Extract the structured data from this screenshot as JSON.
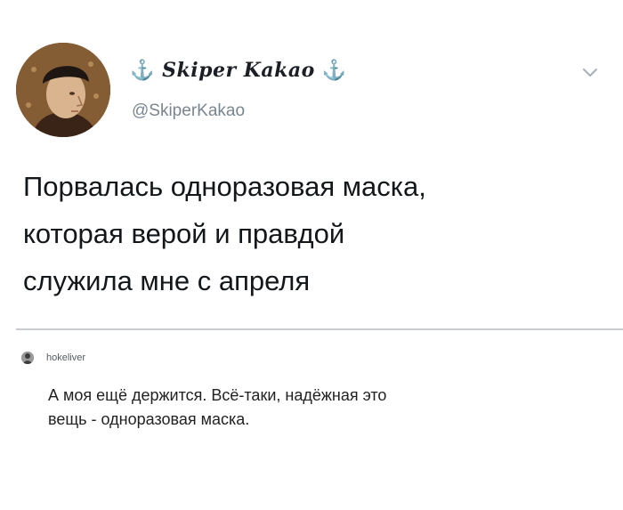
{
  "tweet": {
    "display_name": "Skiper Kakao",
    "display_name_decoration": "⚓",
    "handle": "@SkiperKakao",
    "text": "Порвалась одноразовая маска,\nкоторая верой и правдой\nслужила мне с апреля",
    "menu_icon": "chevron-down-icon",
    "avatar": "avatar"
  },
  "reply": {
    "username": "hokeliver",
    "text": "А моя ещё держится. Всё-таки, надёжная это\nвещь - одноразовая маска."
  },
  "colors": {
    "background": "#ffffff",
    "text": "#14171a",
    "muted": "#7a868f",
    "divider": "#c9cdd1",
    "anchor": "#2c6fb3"
  }
}
